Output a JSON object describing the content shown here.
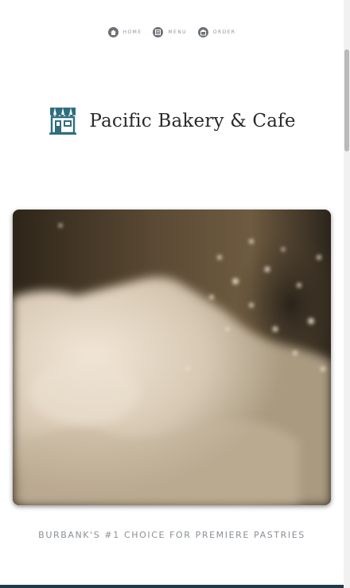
{
  "nav": {
    "items": [
      {
        "label": "HOME",
        "icon": "home-icon"
      },
      {
        "label": "MENU",
        "icon": "menu-icon"
      },
      {
        "label": "ORDER",
        "icon": "order-icon"
      }
    ]
  },
  "brand": {
    "name": "Pacific Bakery & Cafe",
    "logo": "storefront-icon",
    "logo_color": "#2e6e7e"
  },
  "tagline": "BURBANK'S #1 CHOICE FOR PREMIERE PASTRIES",
  "colors": {
    "accent": "#2e6e7e",
    "bottom_bar": "#1f3b47",
    "nav_text": "#8e9398",
    "tagline_text": "#8b9095"
  }
}
